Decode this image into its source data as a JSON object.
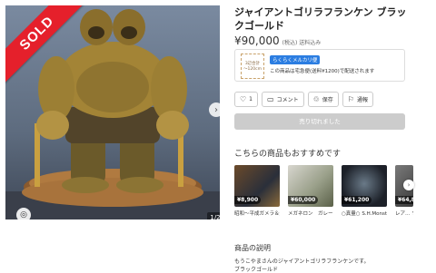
{
  "gallery": {
    "sold_label": "SOLD",
    "counter": "1/2",
    "next_icon": "chevron-right-icon",
    "lens_icon": "camera-lens-icon"
  },
  "item": {
    "title": "ジャイアントゴリラフランケン ブラックゴールド",
    "price": "¥90,000",
    "price_note": "(税込) 送料込み"
  },
  "shipping": {
    "icon_lines": [
      "3辺合計",
      "～120cm"
    ],
    "tag": "らくらくメルカリ便",
    "text": "この商品は宅急便(送料¥1200)で配送されます"
  },
  "actions": [
    {
      "icon": "heart-icon",
      "glyph": "♡",
      "label": "1"
    },
    {
      "icon": "comment-icon",
      "glyph": "▭",
      "label": "コメント"
    },
    {
      "icon": "save-icon",
      "glyph": "♲",
      "label": "保存"
    },
    {
      "icon": "report-icon",
      "glyph": "⚐",
      "label": "通報"
    }
  ],
  "sold_button": "売り切れました",
  "recommend": {
    "title": "こちらの商品もおすすめです",
    "items": [
      {
        "price": "¥8,900",
        "name": "昭和〜平成ガメラ＆登場怪獣（パ…"
      },
      {
        "price": "¥60,000",
        "name": "メガネロン　ガレージキット完成…"
      },
      {
        "price": "¥61,200",
        "name": "○真量○ S.H.MonsterArts…"
      },
      {
        "price": "¥64,8",
        "name": "レア… ソフビ…"
      }
    ]
  },
  "description": {
    "title": "商品の説明",
    "lines": [
      "もうこやまさんのジャイアントゴリラフランケンです。",
      "ブラックゴールド"
    ]
  }
}
